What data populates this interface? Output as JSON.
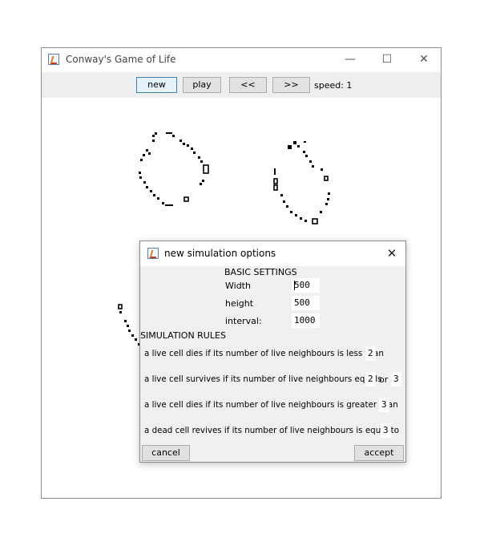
{
  "window": {
    "title": "Conway's Game of Life",
    "controls": {
      "minimize": "—",
      "maximize": "☐",
      "close": "✕"
    }
  },
  "toolbar": {
    "new_label": "new",
    "play_label": "play",
    "back_label": "<<",
    "forward_label": ">>",
    "speed_text": "speed: 1"
  },
  "dialog": {
    "title": "new simulation options",
    "close": "✕",
    "basic_heading": "BASIC SETTINGS",
    "width_label": "Width",
    "width_value": "500",
    "height_label": "height",
    "height_value": "500",
    "interval_label": "interval:",
    "interval_value": "1000",
    "rules_heading": "SIMULATION RULES",
    "rule1_text": "a live cell dies if its number of live neighbours is less than",
    "rule1_value": "2",
    "rule2_text": "a live cell survives if its number of live neighbours equals",
    "rule2_value_a": "2",
    "rule2_or": "or",
    "rule2_value_b": "3",
    "rule3_text": "a live cell dies if its number of live neighbours is greater than",
    "rule3_value": "3",
    "rule4_text": "a dead cell revives if its number of live neighbours is equal to",
    "rule4_value": "3",
    "cancel_label": "cancel",
    "accept_label": "accept"
  },
  "icons": {
    "app": "java-coffee-cup-icon"
  },
  "colors": {
    "toolbar_bg": "#eeeeee",
    "dialog_bg": "#f0f0f0",
    "focus_border": "#3c7fb1",
    "cells": "#000000"
  }
}
